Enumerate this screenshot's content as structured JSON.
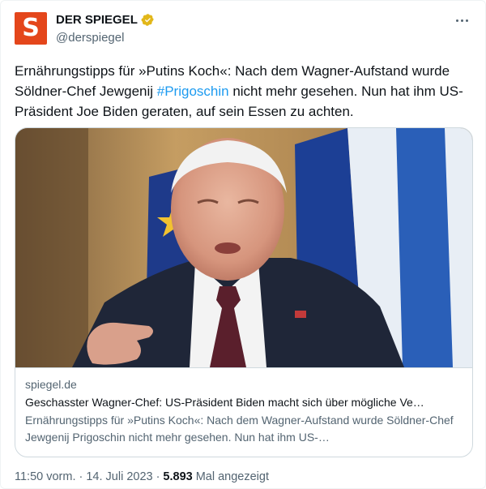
{
  "author": {
    "display_name": "DER SPIEGEL",
    "handle": "@derspiegel",
    "avatar_letter": "S"
  },
  "tweet": {
    "text_before": "Ernährungstipps für »Putins Koch«: Nach dem Wagner-Aufstand wurde Söldner-Chef Jewgenij ",
    "hashtag": "#Prigoschin",
    "text_after": " nicht mehr gesehen. Nun hat ihm US-Präsident Joe Biden geraten, auf sein Essen zu achten."
  },
  "card": {
    "domain": "spiegel.de",
    "title": "Geschasster Wagner-Chef: US-Präsident Biden macht sich über mögliche Ve…",
    "description": "Ernährungstipps für »Putins Koch«: Nach dem Wagner-Aufstand wurde Söldner-Chef Jewgenij Prigoschin nicht mehr gesehen. Nun hat ihm US-…"
  },
  "footer": {
    "time": "11:50 vorm.",
    "separator1": "·",
    "date": "14. Juli 2023",
    "separator2": "·",
    "views_count": "5.893",
    "views_label": "Mal angezeigt"
  },
  "colors": {
    "brand": "#e4461b",
    "link": "#1d9bf0",
    "verified": "#e2b719"
  }
}
